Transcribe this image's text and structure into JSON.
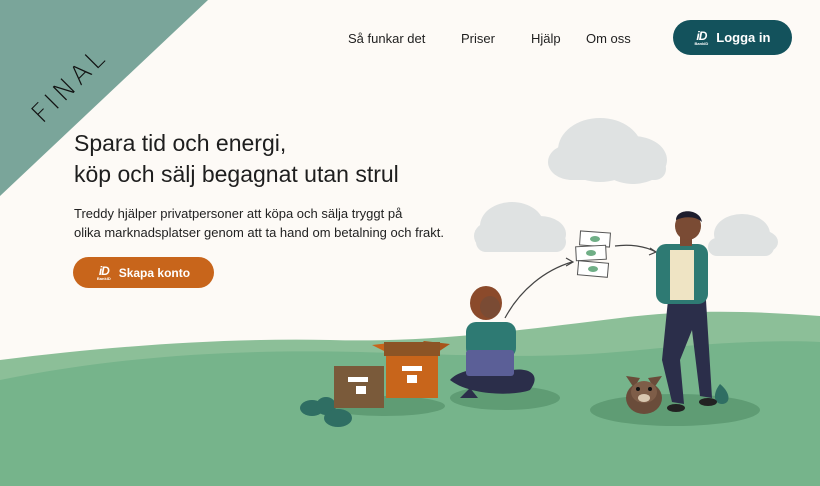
{
  "corner": {
    "label": "FINAL",
    "color": "#7aa59a"
  },
  "nav": {
    "links": [
      "Så funkar det",
      "Priser",
      "Hjälp",
      "Om oss"
    ],
    "login_label": "Logga in",
    "bankid_text": "BankID"
  },
  "hero": {
    "headline_line1": "Spara tid och energi,",
    "headline_line2": "köp och sälj begagnat utan strul",
    "sub_line1": "Treddy hjälper privatpersoner att köpa och sälja tryggt på",
    "sub_line2": "olika marknadsplatser genom att ta hand om betalning och frakt.",
    "signup_label": "Skapa konto"
  },
  "colors": {
    "primary": "#13525c",
    "accent": "#c8651b",
    "ground": "#6fae86",
    "background": "#fdfaf6"
  }
}
